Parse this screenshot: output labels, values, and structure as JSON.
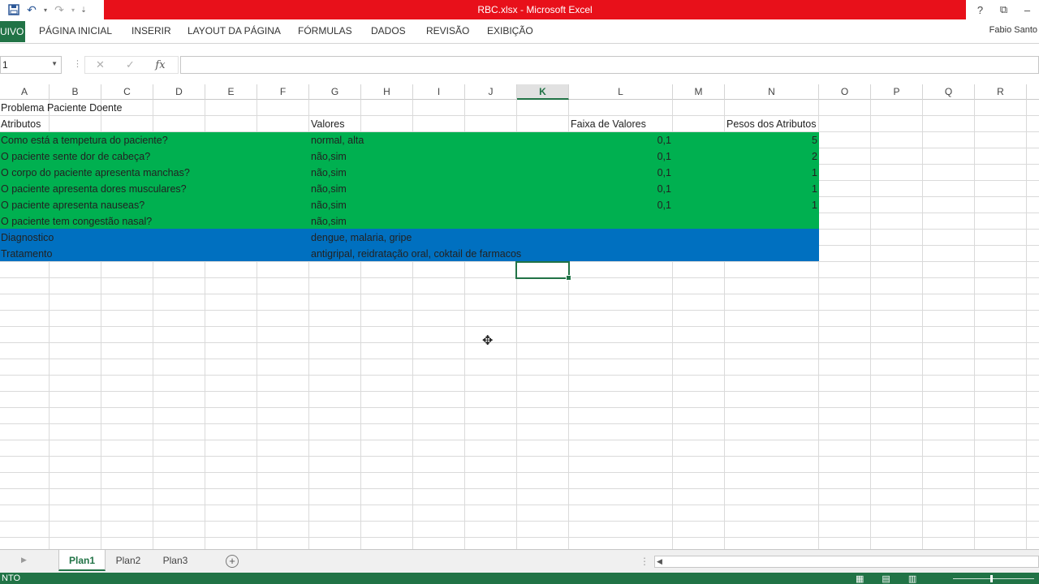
{
  "window": {
    "title": "RBC.xlsx - Microsoft Excel",
    "user": "Fabio Santo"
  },
  "qat": {
    "save_icon": "save-icon",
    "undo_icon": "undo-icon",
    "redo_icon": "redo-icon"
  },
  "ribbon": {
    "file_label": "UIVO",
    "tabs": [
      "PÁGINA INICIAL",
      "INSERIR",
      "LAYOUT DA PÁGINA",
      "FÓRMULAS",
      "DADOS",
      "REVISÃO",
      "EXIBIÇÃO"
    ]
  },
  "formula_bar": {
    "name_box": "1",
    "fx_label": "fx",
    "value": ""
  },
  "columns": [
    "A",
    "B",
    "C",
    "D",
    "E",
    "F",
    "G",
    "H",
    "I",
    "J",
    "K",
    "L",
    "M",
    "N",
    "O",
    "P",
    "Q",
    "R"
  ],
  "selected_column": "K",
  "colors": {
    "green_fill": "#00b050",
    "blue_fill": "#0070c0",
    "excel_green": "#217346",
    "title_red": "#e8101a"
  },
  "sheet": {
    "title": "Problema Paciente Doente",
    "headers": {
      "atributos": "Atributos",
      "valores": "Valores",
      "faixa": "Faixa de Valores",
      "pesos": "Pesos dos Atributos"
    },
    "rows": [
      {
        "atributo": "Como está a tempetura do paciente?",
        "valores": "normal, alta",
        "faixa": "0,1",
        "peso": "5"
      },
      {
        "atributo": "O paciente sente dor de cabeça?",
        "valores": "não,sim",
        "faixa": "0,1",
        "peso": "2"
      },
      {
        "atributo": "O corpo do paciente apresenta manchas?",
        "valores": "não,sim",
        "faixa": "0,1",
        "peso": "1"
      },
      {
        "atributo": "O paciente apresenta dores musculares?",
        "valores": "não,sim",
        "faixa": "0,1",
        "peso": "1"
      },
      {
        "atributo": "O paciente apresenta nauseas?",
        "valores": "não,sim",
        "faixa": "0,1",
        "peso": "1"
      },
      {
        "atributo": "O paciente tem congestão nasal?",
        "valores": "não,sim",
        "faixa": "",
        "peso": ""
      }
    ],
    "diagnostico": {
      "label": "Diagnostico",
      "value": "dengue, malaria, gripe"
    },
    "tratamento": {
      "label": "Tratamento",
      "value": "antigripal, reidratação oral,  coktail de farmacos"
    }
  },
  "sheet_tabs": [
    "Plan1",
    "Plan2",
    "Plan3"
  ],
  "active_sheet": "Plan1",
  "status": {
    "mode": "NTO"
  }
}
